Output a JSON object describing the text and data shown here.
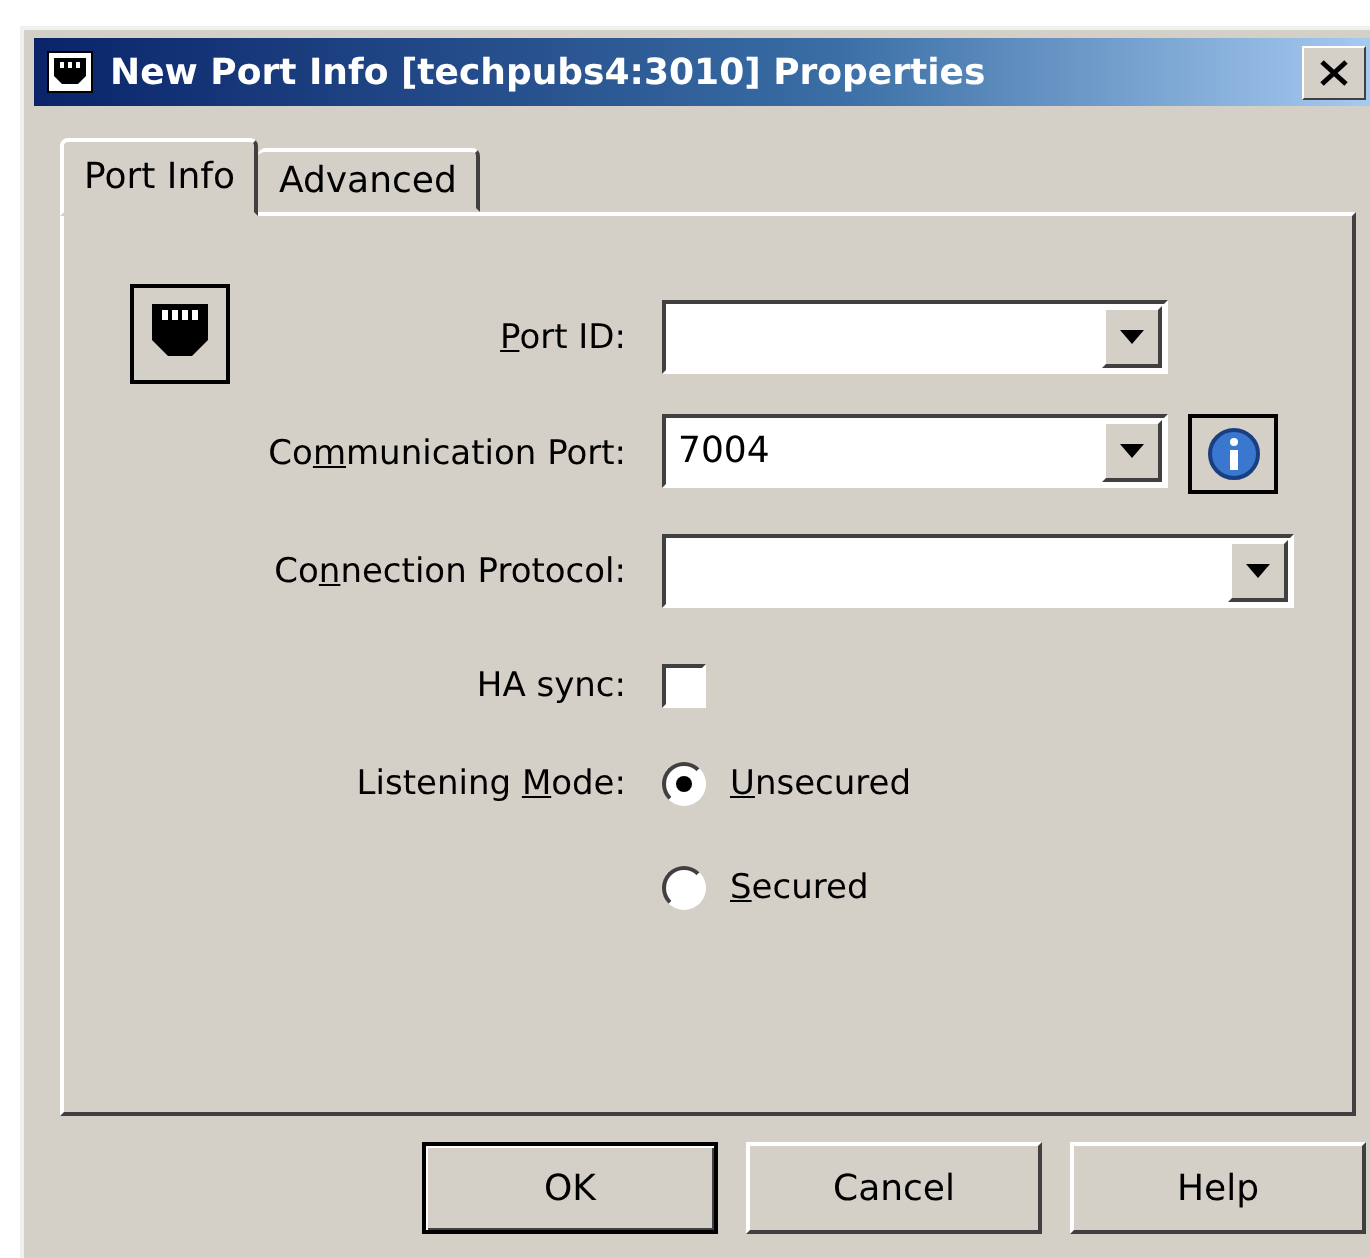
{
  "window": {
    "title": "New Port Info [techpubs4:3010] Properties"
  },
  "tabs": [
    {
      "label": "Port Info",
      "selected": true
    },
    {
      "label": "Advanced",
      "selected": false
    }
  ],
  "fields": [
    {
      "kind": "combo",
      "label": {
        "mnemonic": "P",
        "after": "ort ID:"
      },
      "wide": false
    },
    {
      "kind": "combo",
      "label": {
        "before": "Co",
        "mnemonic": "m",
        "after": "munication Port:"
      },
      "value": "7004",
      "wide": false,
      "info_button": true
    },
    {
      "kind": "combo",
      "label": {
        "before": "Co",
        "mnemonic": "n",
        "after": "nection Protocol:"
      },
      "wide": true
    },
    {
      "kind": "checkbox",
      "label": {
        "before": "HA sync:"
      },
      "checked": false
    },
    {
      "kind": "radio",
      "label": {
        "before": "Listening ",
        "mnemonic": "M",
        "after": "ode:"
      },
      "options": [
        {
          "label": {
            "mnemonic": "U",
            "after": "nsecured"
          },
          "selected": true
        },
        {
          "label": {
            "mnemonic": "S",
            "after": "ecured"
          },
          "selected": false
        }
      ]
    }
  ],
  "buttons": [
    {
      "label": "OK",
      "default": true
    },
    {
      "label": "Cancel",
      "default": false
    },
    {
      "label": "Help",
      "default": false
    }
  ]
}
